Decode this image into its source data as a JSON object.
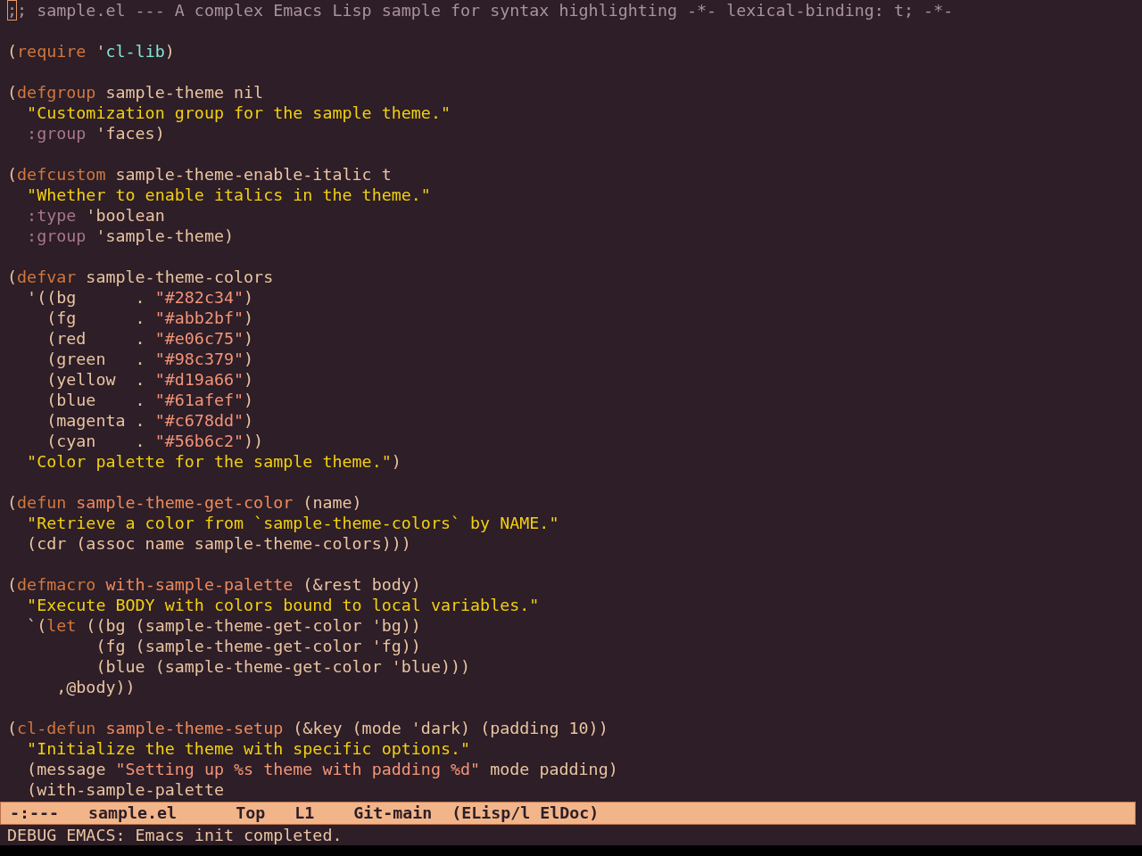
{
  "buffer": {
    "blocks": [
      {
        "lines": [
          {
            "tokens": [
              {
                "text": ";",
                "kind": "cursor"
              },
              {
                "text": "; sample.el --- A complex Emacs Lisp sample for syntax highlighting -*- lexical-binding: t; -*-",
                "kind": "comment"
              }
            ]
          }
        ]
      },
      {
        "lines": [
          {
            "tokens": [
              {
                "text": "(",
                "kind": "plain"
              },
              {
                "text": "require",
                "kind": "keyword"
              },
              {
                "text": " '",
                "kind": "plain"
              },
              {
                "text": "cl-lib",
                "kind": "constant"
              },
              {
                "text": ")",
                "kind": "plain"
              }
            ]
          }
        ]
      },
      {
        "lines": [
          {
            "tokens": [
              {
                "text": "(",
                "kind": "plain"
              },
              {
                "text": "defgroup",
                "kind": "keyword"
              },
              {
                "text": " sample-theme nil",
                "kind": "plain"
              }
            ]
          },
          {
            "tokens": [
              {
                "text": "  \"Customization group for the sample theme.\"",
                "kind": "docstring"
              }
            ]
          },
          {
            "tokens": [
              {
                "text": "  :group",
                "kind": "builtin"
              },
              {
                "text": " 'faces)",
                "kind": "plain"
              }
            ]
          }
        ]
      },
      {
        "lines": [
          {
            "tokens": [
              {
                "text": "(",
                "kind": "plain"
              },
              {
                "text": "defcustom",
                "kind": "keyword"
              },
              {
                "text": " sample-theme-enable-italic t",
                "kind": "plain"
              }
            ]
          },
          {
            "tokens": [
              {
                "text": "  \"Whether to enable italics in the theme.\"",
                "kind": "docstring"
              }
            ]
          },
          {
            "tokens": [
              {
                "text": "  :type",
                "kind": "builtin"
              },
              {
                "text": " 'boolean",
                "kind": "plain"
              }
            ]
          },
          {
            "tokens": [
              {
                "text": "  :group",
                "kind": "builtin"
              },
              {
                "text": " 'sample-theme)",
                "kind": "plain"
              }
            ]
          }
        ]
      },
      {
        "lines": [
          {
            "tokens": [
              {
                "text": "(",
                "kind": "plain"
              },
              {
                "text": "defvar",
                "kind": "keyword"
              },
              {
                "text": " sample-theme-colors",
                "kind": "plain"
              }
            ]
          },
          {
            "tokens": [
              {
                "text": "  '((bg      . ",
                "kind": "plain"
              },
              {
                "text": "\"#282c34\"",
                "kind": "string"
              },
              {
                "text": ")",
                "kind": "plain"
              }
            ]
          },
          {
            "tokens": [
              {
                "text": "    (fg      . ",
                "kind": "plain"
              },
              {
                "text": "\"#abb2bf\"",
                "kind": "string"
              },
              {
                "text": ")",
                "kind": "plain"
              }
            ]
          },
          {
            "tokens": [
              {
                "text": "    (red     . ",
                "kind": "plain"
              },
              {
                "text": "\"#e06c75\"",
                "kind": "string"
              },
              {
                "text": ")",
                "kind": "plain"
              }
            ]
          },
          {
            "tokens": [
              {
                "text": "    (green   . ",
                "kind": "plain"
              },
              {
                "text": "\"#98c379\"",
                "kind": "string"
              },
              {
                "text": ")",
                "kind": "plain"
              }
            ]
          },
          {
            "tokens": [
              {
                "text": "    (yellow  . ",
                "kind": "plain"
              },
              {
                "text": "\"#d19a66\"",
                "kind": "string"
              },
              {
                "text": ")",
                "kind": "plain"
              }
            ]
          },
          {
            "tokens": [
              {
                "text": "    (blue    . ",
                "kind": "plain"
              },
              {
                "text": "\"#61afef\"",
                "kind": "string"
              },
              {
                "text": ")",
                "kind": "plain"
              }
            ]
          },
          {
            "tokens": [
              {
                "text": "    (magenta . ",
                "kind": "plain"
              },
              {
                "text": "\"#c678dd\"",
                "kind": "string"
              },
              {
                "text": ")",
                "kind": "plain"
              }
            ]
          },
          {
            "tokens": [
              {
                "text": "    (cyan    . ",
                "kind": "plain"
              },
              {
                "text": "\"#56b6c2\"",
                "kind": "string"
              },
              {
                "text": "))",
                "kind": "plain"
              }
            ]
          },
          {
            "tokens": [
              {
                "text": "  \"Color palette for the sample theme.\"",
                "kind": "docstring"
              },
              {
                "text": ")",
                "kind": "plain"
              }
            ]
          }
        ]
      },
      {
        "lines": [
          {
            "tokens": [
              {
                "text": "(",
                "kind": "plain"
              },
              {
                "text": "defun",
                "kind": "keyword"
              },
              {
                "text": " sample-theme-get-color",
                "kind": "function"
              },
              {
                "text": " (name)",
                "kind": "plain"
              }
            ]
          },
          {
            "tokens": [
              {
                "text": "  \"Retrieve a color from `sample-theme-colors` by NAME.\"",
                "kind": "docstring"
              }
            ]
          },
          {
            "tokens": [
              {
                "text": "  (cdr (assoc name sample-theme-colors)))",
                "kind": "plain"
              }
            ]
          }
        ]
      },
      {
        "lines": [
          {
            "tokens": [
              {
                "text": "(",
                "kind": "plain"
              },
              {
                "text": "defmacro",
                "kind": "keyword"
              },
              {
                "text": " with-sample-palette",
                "kind": "function"
              },
              {
                "text": " (&rest body)",
                "kind": "plain"
              }
            ]
          },
          {
            "tokens": [
              {
                "text": "  \"Execute BODY with colors bound to local variables.\"",
                "kind": "docstring"
              }
            ]
          },
          {
            "tokens": [
              {
                "text": "  `(",
                "kind": "plain"
              },
              {
                "text": "let",
                "kind": "keyword"
              },
              {
                "text": " ((bg (sample-theme-get-color 'bg))",
                "kind": "plain"
              }
            ]
          },
          {
            "tokens": [
              {
                "text": "         (fg (sample-theme-get-color 'fg))",
                "kind": "plain"
              }
            ]
          },
          {
            "tokens": [
              {
                "text": "         (blue (sample-theme-get-color 'blue)))",
                "kind": "plain"
              }
            ]
          },
          {
            "tokens": [
              {
                "text": "     ,@body))",
                "kind": "plain"
              }
            ]
          }
        ]
      },
      {
        "lines": [
          {
            "tokens": [
              {
                "text": "(",
                "kind": "plain"
              },
              {
                "text": "cl-defun",
                "kind": "keyword"
              },
              {
                "text": " sample-theme-setup",
                "kind": "function"
              },
              {
                "text": " (&key (mode 'dark) (padding 10))",
                "kind": "plain"
              }
            ]
          },
          {
            "tokens": [
              {
                "text": "  \"Initialize the theme with specific options.\"",
                "kind": "docstring"
              }
            ]
          },
          {
            "tokens": [
              {
                "text": "  (message ",
                "kind": "plain"
              },
              {
                "text": "\"Setting up %s theme with padding %d\"",
                "kind": "string"
              },
              {
                "text": " mode padding)",
                "kind": "plain"
              }
            ]
          },
          {
            "tokens": [
              {
                "text": "  (with-sample-palette",
                "kind": "plain"
              }
            ]
          }
        ]
      }
    ]
  },
  "mode_line": {
    "status": "-:---",
    "buffer_name": "sample.el",
    "position": "Top",
    "line": "L1",
    "vc": "Git-main",
    "modes": "(ELisp/l ElDoc)"
  },
  "echo_area": {
    "message": "DEBUG EMACS: Emacs init completed."
  }
}
